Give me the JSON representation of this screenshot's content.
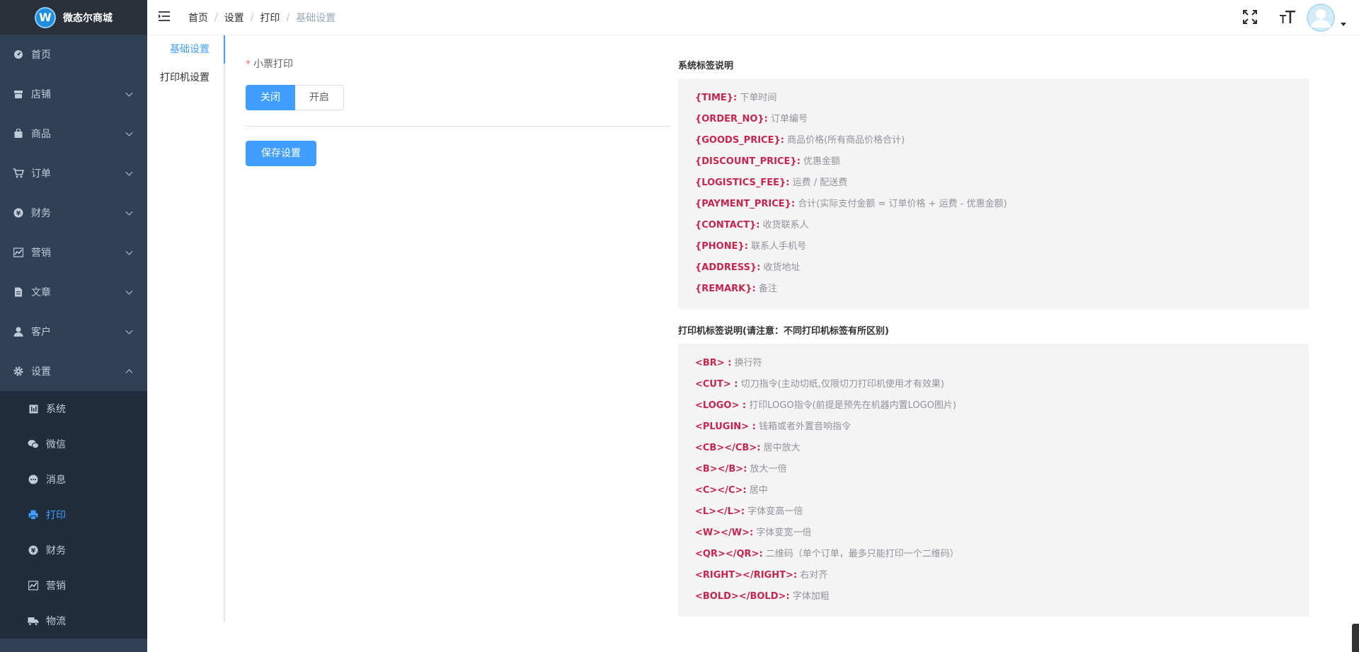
{
  "app": {
    "name": "微态尔商城",
    "logo_letter": "W"
  },
  "sidebar": {
    "items": [
      {
        "label": "首页",
        "icon": "dashboard-icon",
        "has_children": false
      },
      {
        "label": "店铺",
        "icon": "store-icon",
        "has_children": true
      },
      {
        "label": "商品",
        "icon": "bag-icon",
        "has_children": true
      },
      {
        "label": "订单",
        "icon": "cart-icon",
        "has_children": true
      },
      {
        "label": "财务",
        "icon": "yen-icon",
        "has_children": true
      },
      {
        "label": "营销",
        "icon": "chart-icon",
        "has_children": true
      },
      {
        "label": "文章",
        "icon": "document-icon",
        "has_children": true
      },
      {
        "label": "客户",
        "icon": "user-icon",
        "has_children": true
      },
      {
        "label": "设置",
        "icon": "gear-icon",
        "has_children": true,
        "expanded": true
      }
    ],
    "sub_items": [
      {
        "label": "系统",
        "icon": "system-icon"
      },
      {
        "label": "微信",
        "icon": "wechat-icon"
      },
      {
        "label": "消息",
        "icon": "message-icon"
      },
      {
        "label": "打印",
        "icon": "printer-icon",
        "active": true
      },
      {
        "label": "财务",
        "icon": "yen-icon"
      },
      {
        "label": "营销",
        "icon": "chart-icon"
      },
      {
        "label": "物流",
        "icon": "truck-icon"
      }
    ]
  },
  "header": {
    "breadcrumb": [
      "首页",
      "设置",
      "打印",
      "基础设置"
    ],
    "separator": "/"
  },
  "tabs": [
    {
      "label": "基础设置",
      "active": true
    },
    {
      "label": "打印机设置",
      "active": false
    }
  ],
  "form": {
    "receipt_label": "小票打印",
    "required_mark": "*",
    "toggle_off": "关闭",
    "toggle_on": "开启",
    "toggle_value": "关闭",
    "save_label": "保存设置"
  },
  "system_tags": {
    "title": "系统标签说明",
    "rows": [
      {
        "tag": "{TIME}:",
        "desc": "下单时间"
      },
      {
        "tag": "{ORDER_NO}:",
        "desc": "订单编号"
      },
      {
        "tag": "{GOODS_PRICE}:",
        "desc": "商品价格(所有商品价格合计)"
      },
      {
        "tag": "{DISCOUNT_PRICE}:",
        "desc": "优惠金额"
      },
      {
        "tag": "{LOGISTICS_FEE}:",
        "desc": "运费 / 配送费"
      },
      {
        "tag": "{PAYMENT_PRICE}:",
        "desc": "合计(实际支付金额 = 订单价格 + 运费 - 优惠金额)"
      },
      {
        "tag": "{CONTACT}:",
        "desc": "收货联系人"
      },
      {
        "tag": "{PHONE}:",
        "desc": "联系人手机号"
      },
      {
        "tag": "{ADDRESS}:",
        "desc": "收货地址"
      },
      {
        "tag": "{REMARK}:",
        "desc": "备注"
      }
    ]
  },
  "printer_tags": {
    "title": "打印机标签说明(请注意：不同打印机标签有所区别)",
    "rows": [
      {
        "tag": "<BR> :",
        "desc": "换行符"
      },
      {
        "tag": "<CUT> :",
        "desc": "切刀指令(主动切纸,仅限切刀打印机使用才有效果)"
      },
      {
        "tag": "<LOGO> :",
        "desc": "打印LOGO指令(前提是预先在机器内置LOGO图片)"
      },
      {
        "tag": "<PLUGIN> :",
        "desc": "钱箱或者外置音响指令"
      },
      {
        "tag": "<CB></CB>:",
        "desc": "居中放大"
      },
      {
        "tag": "<B></B>:",
        "desc": "放大一倍"
      },
      {
        "tag": "<C></C>:",
        "desc": "居中"
      },
      {
        "tag": "<L></L>:",
        "desc": "字体变高一倍"
      },
      {
        "tag": "<W></W>:",
        "desc": "字体变宽一倍"
      },
      {
        "tag": "<QR></QR>:",
        "desc": "二维码（单个订单，最多只能打印一个二维码）"
      },
      {
        "tag": "<RIGHT></RIGHT>:",
        "desc": "右对齐"
      },
      {
        "tag": "<BOLD></BOLD>:",
        "desc": "字体加粗"
      }
    ]
  },
  "colors": {
    "sidebar_bg": "#304156",
    "sidebar_sub_bg": "#1f2d3d",
    "logo_bg": "#2b2f3a",
    "accent": "#409eff",
    "tag_color": "#c7254e",
    "help_bg": "#f4f4f5"
  }
}
